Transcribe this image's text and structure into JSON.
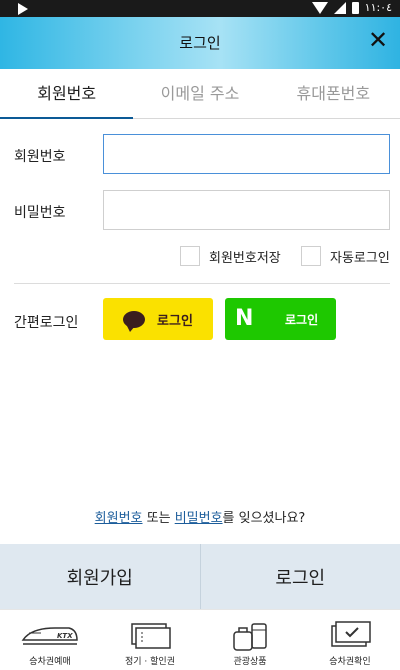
{
  "status_bar": {
    "time": "١١:٠٤"
  },
  "header": {
    "title": "로그인",
    "close_icon": "close-icon"
  },
  "tabs": [
    {
      "label": "회원번호",
      "active": true
    },
    {
      "label": "이메일 주소",
      "active": false
    },
    {
      "label": "휴대폰번호",
      "active": false
    }
  ],
  "form": {
    "member_number_label": "회원번호",
    "member_number_value": "",
    "password_label": "비밀번호",
    "password_value": "",
    "save_member_number_label": "회원번호저장",
    "auto_login_label": "자동로그인"
  },
  "simple_login": {
    "label": "간편로그인",
    "kakao_label": "로그인",
    "naver_letter": "N",
    "naver_label": "로그인",
    "kakao_color": "#fae100",
    "naver_color": "#1ec800"
  },
  "forgot": {
    "member_number_link": "회원번호",
    "or": " 또는 ",
    "password_link": "비밀번호",
    "suffix": "를 잊으셨나요?"
  },
  "actions": {
    "signup_label": "회원가입",
    "login_label": "로그인"
  },
  "bottom_nav": [
    {
      "label": "승차권예매",
      "icon": "ktx-train-icon"
    },
    {
      "label": "정기 · 할인권",
      "icon": "pass-tickets-icon"
    },
    {
      "label": "관광상품",
      "icon": "travel-goods-icon"
    },
    {
      "label": "승차권확인",
      "icon": "ticket-check-icon"
    }
  ],
  "colors": {
    "accent": "#0c5a96",
    "link": "#1c5d9b",
    "focus": "#4a90d9",
    "action_bg": "#dfe8f0"
  }
}
